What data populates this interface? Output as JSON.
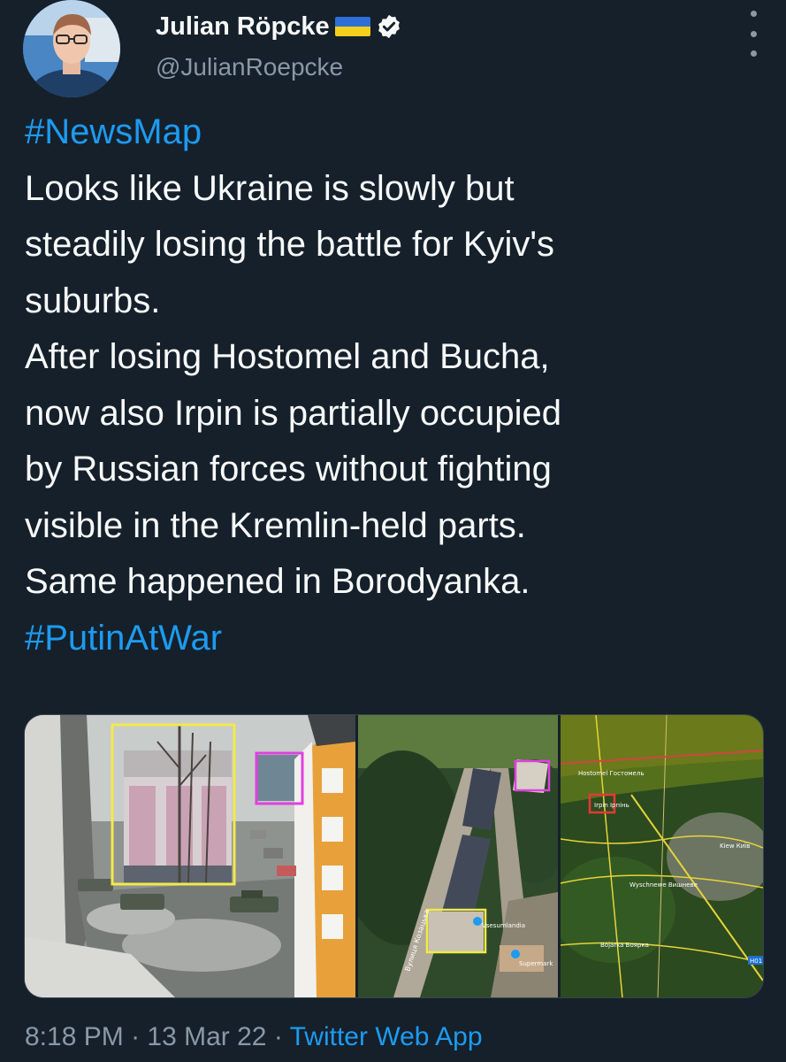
{
  "tweet": {
    "author_name": "Julian Röpcke",
    "handle": "@JulianRoepcke",
    "lines": [
      {
        "text": "#NewsMap",
        "type": "hashtag"
      },
      {
        "text": "Looks like Ukraine is slowly but",
        "type": "text"
      },
      {
        "text": "steadily losing the battle for Kyiv's",
        "type": "text"
      },
      {
        "text": "suburbs.",
        "type": "text"
      },
      {
        "text": "After losing Hostomel and Bucha,",
        "type": "text"
      },
      {
        "text": "now also Irpin is partially occupied",
        "type": "text"
      },
      {
        "text": "by Russian forces without fighting",
        "type": "text"
      },
      {
        "text": "visible in the Kremlin-held parts.",
        "type": "text"
      },
      {
        "text": "Same happened in Borodyanka.",
        "type": "text"
      },
      {
        "text": "#PutinAtWar",
        "type": "hashtag"
      }
    ],
    "time": "8:18 PM",
    "sep1": "·",
    "date": "13 Mar 22",
    "sep2": "·",
    "source": "Twitter Web App"
  },
  "media": {
    "map_labels": {
      "hostomel": "Hostomel Гостомель",
      "irpin": "Irpin Ірпінь",
      "kiew": "Kiew Київ",
      "wyschnewe": "Wyschnewe Вишневе",
      "bojarka": "Bojarka Боярка",
      "road_h01": "H01"
    },
    "sat_labels": {
      "street": "Вулиця Козацька",
      "place1": "Vsesumlandia",
      "place2": "Supermark"
    }
  },
  "colors": {
    "background": "#15202b",
    "text": "#f7f9f9",
    "secondary": "#8b98a5",
    "link": "#1d9bf0",
    "highlight_yellow": "#f2ea4a",
    "highlight_magenta": "#e040e0",
    "highlight_red": "#e53935"
  }
}
